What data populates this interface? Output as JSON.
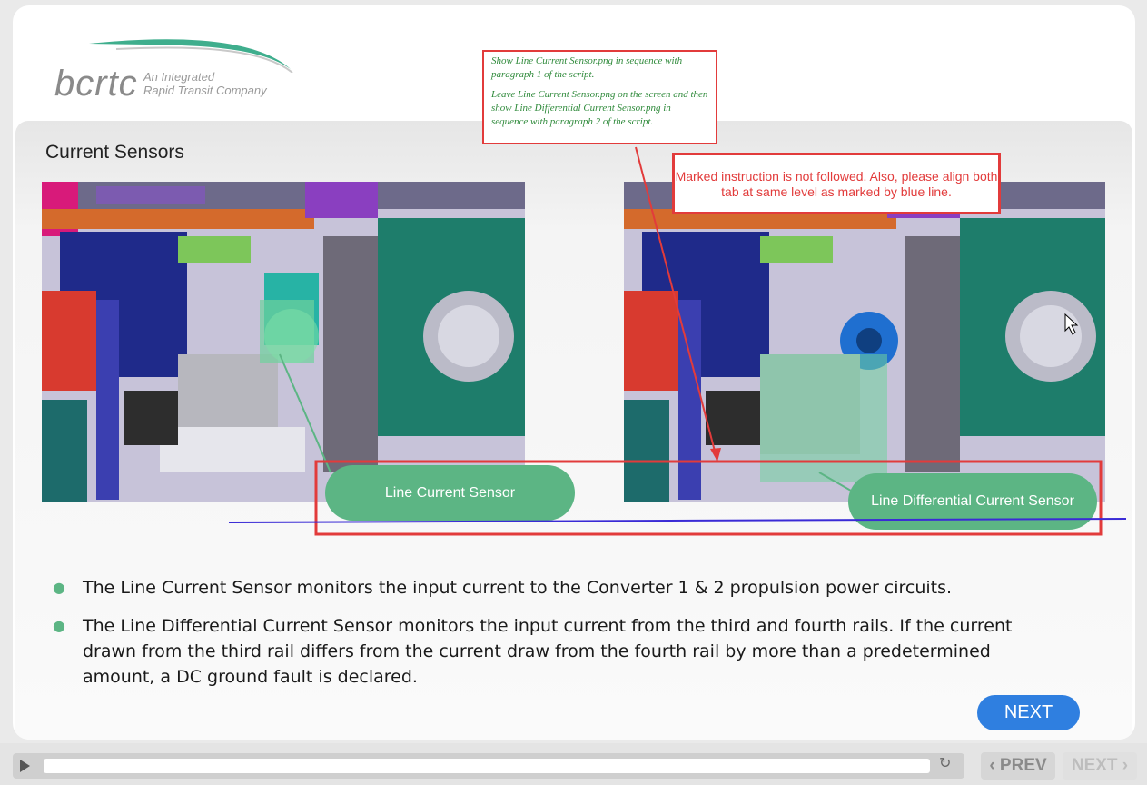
{
  "logo": {
    "text": "bcrtc",
    "tagline_line1": "An Integrated",
    "tagline_line2": "Rapid Transit Company"
  },
  "slide": {
    "title": "Current Sensors",
    "labels": {
      "line_current_sensor": "Line Current Sensor",
      "line_differential_current_sensor": "Line Differential Current Sensor"
    },
    "bullets": [
      "The Line Current Sensor monitors the input current to the Converter 1 & 2 propulsion power circuits.",
      "The Line Differential Current Sensor monitors the input current from the third and fourth rails. If the current drawn from the third rail differs from the current draw from the fourth rail by more than a predetermined amount, a DC ground fault is declared."
    ],
    "next_button": "NEXT"
  },
  "annotations": {
    "instruction_note": [
      "Show Line Current Sensor.png in sequence with paragraph 1 of the script.",
      "Leave Line Current Sensor.png on the screen and then show Line Differential Current Sensor.png in sequence with paragraph 2 of the script."
    ],
    "review_comment": "Marked instruction is not followed. Also, please align both tab at same level as marked by blue line."
  },
  "player": {
    "prev_label": "‹ PREV",
    "next_label": "NEXT ›"
  },
  "colors": {
    "accent_green": "#5cb584",
    "annotation_red": "#e23b3b",
    "next_blue": "#2f7fe0",
    "alignment_line": "#3a2bd6"
  }
}
